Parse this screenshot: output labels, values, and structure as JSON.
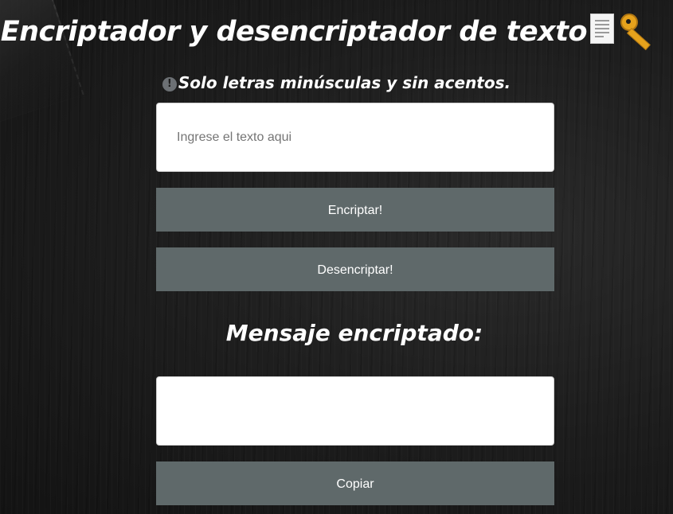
{
  "header": {
    "title": "Encriptador y desencriptador de texto",
    "icons": [
      "page-document-icon",
      "key-icon"
    ]
  },
  "notice": {
    "icon": "exclamation-circle-icon",
    "text": "Solo letras minúsculas y sin acentos."
  },
  "input": {
    "placeholder": "Ingrese el texto aqui",
    "value": ""
  },
  "actions": {
    "encrypt_label": "Encriptar!",
    "decrypt_label": "Desencriptar!",
    "copy_label": "Copiar"
  },
  "result": {
    "heading": "Mensaje encriptado:",
    "value": ""
  },
  "colors": {
    "background": "#1c1c1c",
    "button": "#5f696a",
    "text": "#ffffff"
  }
}
